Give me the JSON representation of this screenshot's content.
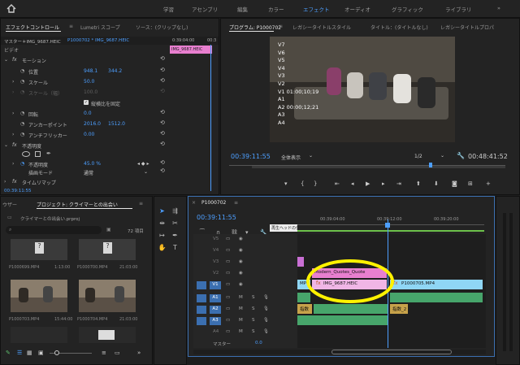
{
  "workspaces": {
    "home_icon": "home-icon",
    "items": [
      "学習",
      "アセンブリ",
      "編集",
      "カラー",
      "エフェクト",
      "オーディオ",
      "グラフィック",
      "ライブラリ"
    ],
    "active": "エフェクト"
  },
  "effect_controls": {
    "tabs": [
      "エフェクトコントロール",
      "Lumetri スコープ",
      "ソース：(クリップなし)"
    ],
    "master_label": "マスター＊IMG_9687.HEIC",
    "clip_label": "P1000702 * IMG_9687.HEIC",
    "timecode_start": "0:39:04:00",
    "timecode_end": "00:3",
    "mini_clip": "IMG_9687.HEIC",
    "video_label": "ビデオ",
    "motion": "モーション",
    "position": {
      "label": "位置",
      "x": "948.1",
      "y": "344.2"
    },
    "scale": {
      "label": "スケール",
      "value": "50.0"
    },
    "scale_width": {
      "label": "スケール（幅）",
      "value": "100.0"
    },
    "uniform": "縦横比を固定",
    "rotation": {
      "label": "回転",
      "value": "0.0"
    },
    "anchor": {
      "label": "アンカーポイント",
      "x": "2016.0",
      "y": "1512.0"
    },
    "flicker": {
      "label": "アンチフリッカー",
      "value": "0.00"
    },
    "opacity": "不透明度",
    "opacity_value": {
      "label": "不透明度",
      "value": "45.0 %"
    },
    "blend": {
      "label": "描画モード",
      "value": "通常"
    },
    "timeremap": "タイムリマップ",
    "timecode": "00:39:11:55"
  },
  "program": {
    "tabs": [
      "プログラム: P1000702",
      "レガシータイトルスタイル",
      "タイトル：(タイトルなし)",
      "レガシータイトルプロパ"
    ],
    "overlay": [
      "V7",
      "V6",
      "V5",
      "V4",
      "V3",
      "V2",
      "V1 01:00;10;19",
      "A1",
      "A2 00:00;12;21",
      "A3",
      "A4"
    ],
    "timecode": "00:39:11:55",
    "zoom": "全体表示",
    "quality": "1/2",
    "duration": "00:48:41:52"
  },
  "project": {
    "tabs": [
      "ウザー",
      "プロジェクト: クライマーとの出会い"
    ],
    "file": "クライマーとの出会い.prproj",
    "count": "72 項目",
    "items": [
      {
        "name": "P1000699.MP4",
        "dur": "1:13:00"
      },
      {
        "name": "P1000700.MP4",
        "dur": "21:03:00"
      },
      {
        "name": "P1000703.MP4",
        "dur": "15:44:00"
      },
      {
        "name": "P1000704.MP4",
        "dur": "21:03:00"
      }
    ]
  },
  "timeline": {
    "tab": "P1000702",
    "timecode": "00:39:11:55",
    "ruler": [
      "00:39:04:00",
      "00:39:12:00",
      "00:39:20:00"
    ],
    "tooltip": "再生ヘッドの位置",
    "video_tracks": [
      "V5",
      "V4",
      "V3",
      "V2",
      "V1"
    ],
    "audio_tracks": [
      "A1",
      "A2",
      "A3",
      "A4"
    ],
    "master": "マスター",
    "master_value": "0.0",
    "clips": {
      "title": "Modern_Quotes_Quote",
      "img": "IMG_9687.HEIC",
      "v1_right": "P1000705.MP4",
      "v1_left": "MP4",
      "audio_left": "指数",
      "audio_right": "指数_2"
    }
  },
  "colors": {
    "accent": "#4d9fff",
    "title_clip": "#e87fcf",
    "video_clip": "#8fd6f5",
    "audio_clip": "#47a56b",
    "highlight": "#fff200"
  }
}
